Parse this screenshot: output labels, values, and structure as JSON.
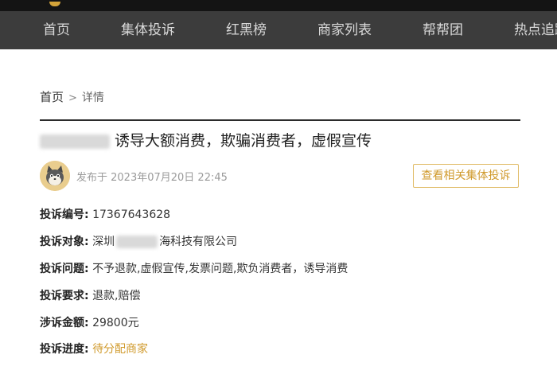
{
  "nav": {
    "items": [
      "首页",
      "集体投诉",
      "红黑榜",
      "商家列表",
      "帮帮团",
      "热点追踪"
    ]
  },
  "breadcrumb": {
    "home": "首页",
    "separator": ">",
    "current": "详情"
  },
  "title_text": "诱导大额消费，欺骗消费者，虚假宣传",
  "publish_time": "发布于 2023年07月20日 22:45",
  "related_button": "查看相关集体投诉",
  "details": {
    "number_label": "投诉编号:",
    "number_value": "17367643628",
    "target_label": "投诉对象:",
    "target_prefix": "深圳",
    "target_suffix": "海科技有限公司",
    "problem_label": "投诉问题:",
    "problem_value": "不予退款,虚假宣传,发票问题,欺负消费者，诱导消费",
    "request_label": "投诉要求:",
    "request_value": "退款,赔偿",
    "amount_label": "涉诉金额:",
    "amount_value": "29800元",
    "progress_label": "投诉进度:",
    "progress_value": "待分配商家"
  },
  "colors": {
    "accent": "#d09a2c",
    "nav_bg": "#3c3c3c",
    "top_bg": "#141414"
  },
  "icons": {
    "avatar": "cartoon-cat-avatar-icon"
  }
}
